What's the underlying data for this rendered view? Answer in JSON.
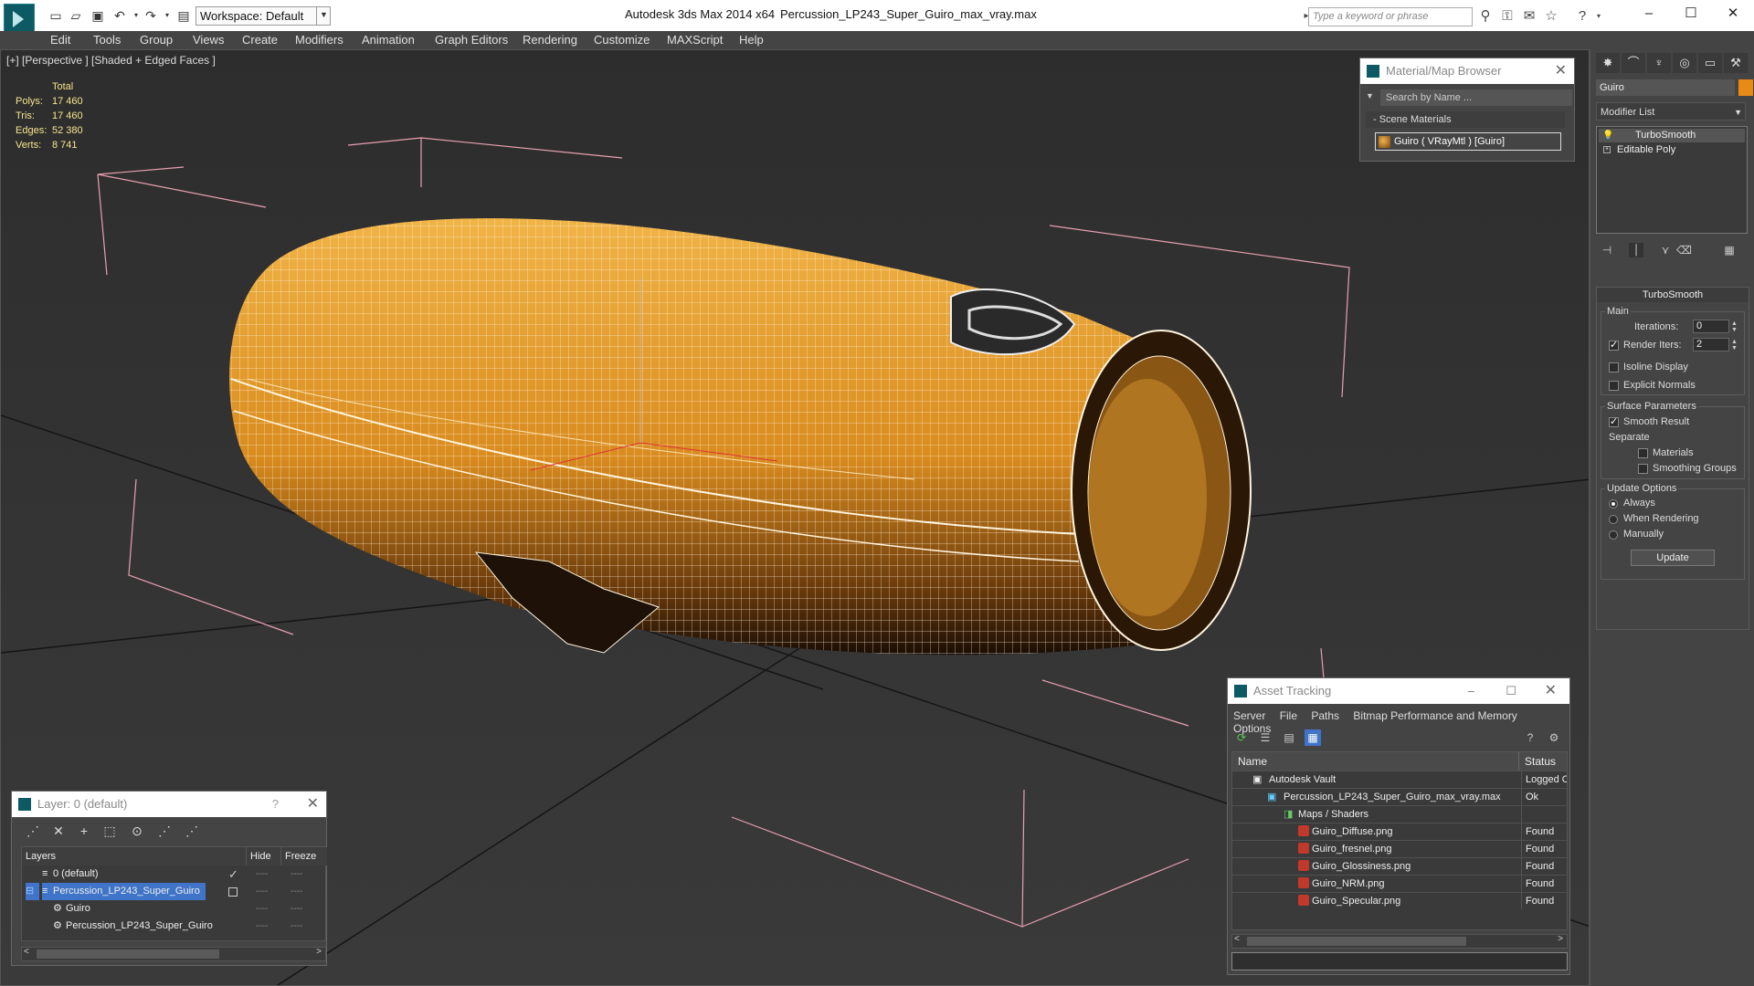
{
  "titlebar": {
    "workspace_label": "Workspace: Default",
    "app_title": "Autodesk 3ds Max  2014 x64",
    "file_title": "Percussion_LP243_Super_Guiro_max_vray.max",
    "search_placeholder": "Type a keyword or phrase"
  },
  "menu": [
    "Edit",
    "Tools",
    "Group",
    "Views",
    "Create",
    "Modifiers",
    "Animation",
    "Graph Editors",
    "Rendering",
    "Customize",
    "MAXScript",
    "Help"
  ],
  "viewport": {
    "label": "[+] [Perspective ] [Shaded + Edged Faces ]",
    "stats_header": "Total",
    "stats": [
      {
        "label": "Polys:",
        "value": "17 460"
      },
      {
        "label": "Tris:",
        "value": "17 460"
      },
      {
        "label": "Edges:",
        "value": "52 380"
      },
      {
        "label": "Verts:",
        "value": "8 741"
      }
    ],
    "mesh_color": "#e3962a"
  },
  "material_browser": {
    "title": "Material/Map Browser",
    "search_placeholder": "Search by Name ...",
    "section": "- Scene Materials",
    "item": "Guiro  ( VRayMtl )  [Guiro]"
  },
  "command_panel": {
    "object_name": "Guiro",
    "object_color": "#e88b14",
    "modifier_list": "Modifier List",
    "stack": [
      "TurboSmooth",
      "Editable Poly"
    ],
    "rollout_title": "TurboSmooth",
    "main_group": "Main",
    "iterations_label": "Iterations:",
    "iterations_value": "0",
    "render_iters_label": "Render Iters:",
    "render_iters_value": "2",
    "isoline_label": "Isoline Display",
    "explicit_normals_label": "Explicit Normals",
    "surface_group": "Surface Parameters",
    "smooth_result_label": "Smooth Result",
    "separate_label": "Separate",
    "materials_label": "Materials",
    "smoothing_groups_label": "Smoothing Groups",
    "update_group": "Update Options",
    "always_label": "Always",
    "when_rendering_label": "When Rendering",
    "manually_label": "Manually",
    "update_button": "Update"
  },
  "layer_explorer": {
    "title": "Layer: 0 (default)",
    "help": "?",
    "columns": [
      "Layers",
      "Hide",
      "Freeze"
    ],
    "rows": [
      {
        "name": "0 (default)",
        "indent": 0
      },
      {
        "name": "Percussion_LP243_Super_Guiro",
        "indent": 0
      },
      {
        "name": "Guiro",
        "indent": 1
      },
      {
        "name": "Percussion_LP243_Super_Guiro",
        "indent": 1
      }
    ]
  },
  "asset_tracking": {
    "title": "Asset Tracking",
    "menu": [
      "Server",
      "File",
      "Paths",
      "Bitmap Performance and Memory",
      "Options"
    ],
    "columns": [
      "Name",
      "Status"
    ],
    "rows": [
      {
        "name": "Autodesk Vault",
        "status": "Logged O",
        "level": 1
      },
      {
        "name": "Percussion_LP243_Super_Guiro_max_vray.max",
        "status": "Ok",
        "level": 2
      },
      {
        "name": "Maps / Shaders",
        "status": "",
        "level": 3
      },
      {
        "name": "Guiro_Diffuse.png",
        "status": "Found",
        "level": 4
      },
      {
        "name": "Guiro_fresnel.png",
        "status": "Found",
        "level": 4
      },
      {
        "name": "Guiro_Glossiness.png",
        "status": "Found",
        "level": 4
      },
      {
        "name": "Guiro_NRM.png",
        "status": "Found",
        "level": 4
      },
      {
        "name": "Guiro_Specular.png",
        "status": "Found",
        "level": 4
      }
    ]
  }
}
